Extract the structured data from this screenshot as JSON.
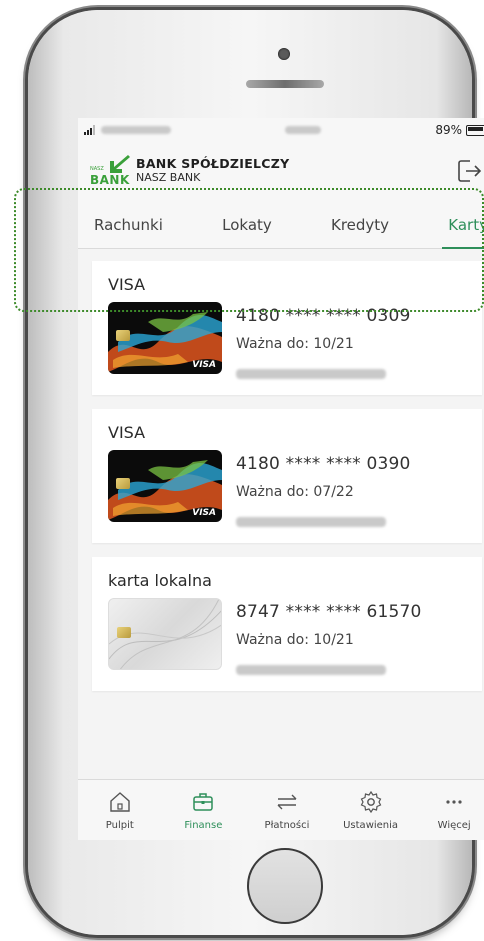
{
  "status_bar": {
    "battery": "89%"
  },
  "header": {
    "bank_line1": "BANK SPÓŁDZIELCZY",
    "bank_line2": "NASZ BANK",
    "logo_text": "BANK",
    "logo_small": "NASZ"
  },
  "tabs": [
    {
      "label": "Rachunki",
      "active": false
    },
    {
      "label": "Lokaty",
      "active": false
    },
    {
      "label": "Kredyty",
      "active": false
    },
    {
      "label": "Karty",
      "active": true
    }
  ],
  "cards": [
    {
      "type": "VISA",
      "number": "4180 **** **** 0309",
      "valid": "Ważna do: 10/21",
      "brand_mark": "VISA"
    },
    {
      "type": "VISA",
      "number": "4180 **** **** 0390",
      "valid": "Ważna do: 07/22",
      "brand_mark": "VISA"
    },
    {
      "type": "karta lokalna",
      "number": "8747 **** **** 61570",
      "valid": "Ważna do: 10/21",
      "brand_mark": ""
    }
  ],
  "bottom_nav": [
    {
      "label": "Pulpit",
      "icon": "home-icon",
      "active": false
    },
    {
      "label": "Finanse",
      "icon": "briefcase-icon",
      "active": true
    },
    {
      "label": "Płatności",
      "icon": "transfer-arrows-icon",
      "active": false
    },
    {
      "label": "Ustawienia",
      "icon": "gear-icon",
      "active": false
    },
    {
      "label": "Więcej",
      "icon": "more-dots-icon",
      "active": false
    }
  ],
  "colors": {
    "accent": "#2e8f5a",
    "logo_green": "#3aa03a",
    "highlight_border": "#3d8a2a"
  }
}
